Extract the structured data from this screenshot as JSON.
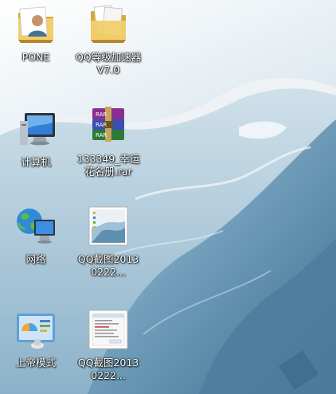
{
  "desktop": {
    "wallpaper": "ice-cave-wallpaper",
    "icons": [
      {
        "label": "PONE",
        "icon": "user-folder-icon"
      },
      {
        "label": "QQ等级加速器V7.0",
        "icon": "folder-icon"
      },
      {
        "label": "计算机",
        "icon": "computer-icon"
      },
      {
        "label": "133349_幸运花名册.rar",
        "icon": "winrar-archive-icon"
      },
      {
        "label": "网络",
        "icon": "network-icon"
      },
      {
        "label": "QQ截图20130222...",
        "icon": "screenshot-image-icon"
      },
      {
        "label": "上帝模式",
        "icon": "control-panel-icon"
      },
      {
        "label": "QQ截图20130222...",
        "icon": "screenshot-image-icon"
      }
    ]
  },
  "colors": {
    "label_text": "#ffffff",
    "folder_yellow": "#e9c35a",
    "rar_purple": "#7a3c8c",
    "ice_blue": "#5f8fac"
  }
}
